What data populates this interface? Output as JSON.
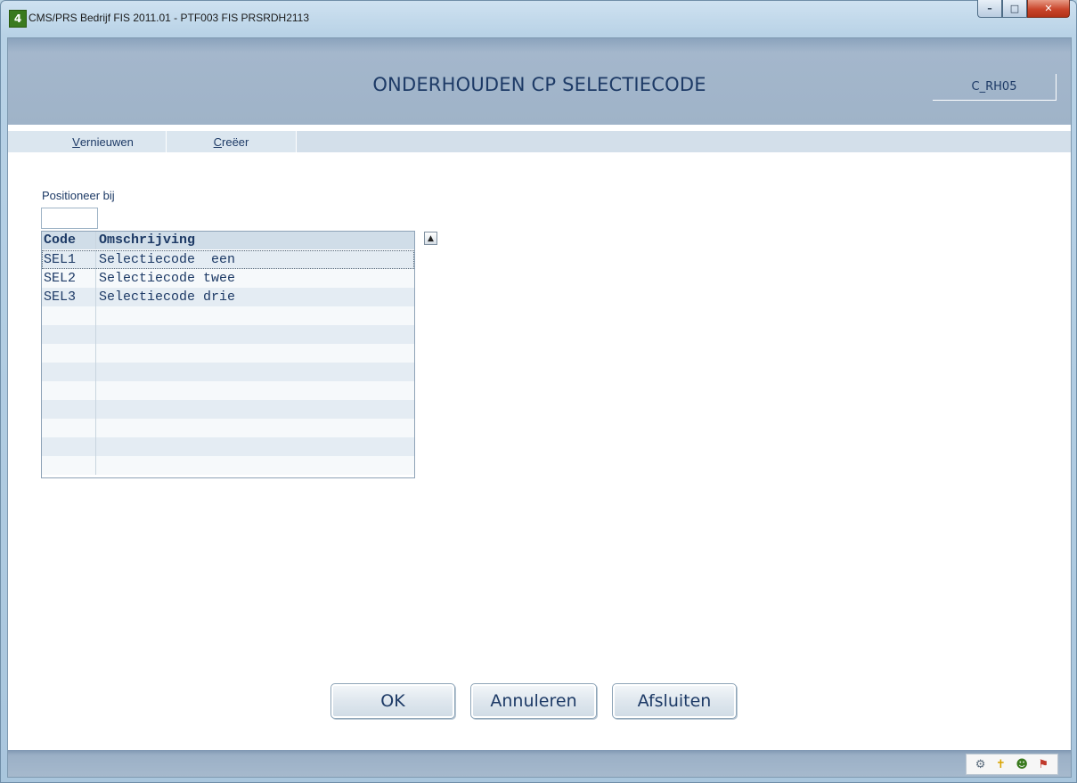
{
  "window": {
    "title": "CMS/PRS  Bedrijf FIS 2011.01  - PTF003 FIS PRSRDH2113",
    "app_icon_glyph": "4",
    "controls": {
      "minimize": "–",
      "maximize": "□",
      "close": "✕"
    }
  },
  "header": {
    "title": "ONDERHOUDEN CP SELECTIECODE",
    "screen_code": "C_RH05"
  },
  "menu": {
    "items": [
      {
        "accel": "V",
        "rest": "ernieuwen"
      },
      {
        "accel": "C",
        "rest": "reëer"
      }
    ]
  },
  "position": {
    "label": "Positioneer bij",
    "value": ""
  },
  "grid": {
    "columns": [
      "Code",
      "Omschrijving"
    ],
    "rows": [
      {
        "code": "SEL1",
        "description": "Selectiecode  een"
      },
      {
        "code": "SEL2",
        "description": "Selectiecode twee"
      },
      {
        "code": "SEL3",
        "description": "Selectiecode drie"
      },
      {
        "code": "",
        "description": ""
      },
      {
        "code": "",
        "description": ""
      },
      {
        "code": "",
        "description": ""
      },
      {
        "code": "",
        "description": ""
      },
      {
        "code": "",
        "description": ""
      },
      {
        "code": "",
        "description": ""
      },
      {
        "code": "",
        "description": ""
      },
      {
        "code": "",
        "description": ""
      },
      {
        "code": "",
        "description": ""
      }
    ],
    "scroll_up_icon": "▲"
  },
  "buttons": {
    "ok": "OK",
    "cancel": "Annuleren",
    "close": "Afsluiten"
  },
  "tray": {
    "icons": [
      "⚙",
      "✝",
      "☻",
      "⚑"
    ]
  }
}
